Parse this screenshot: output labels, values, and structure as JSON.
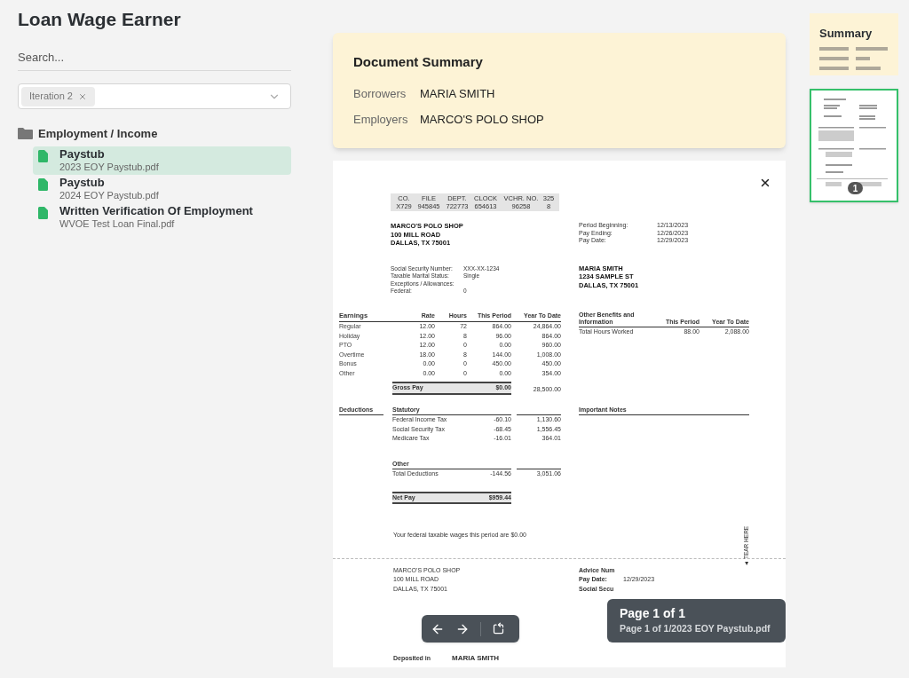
{
  "app_title": "Loan Wage Earner",
  "search": {
    "placeholder": "Search..."
  },
  "filter": {
    "chips": [
      {
        "label": "Iteration 2"
      }
    ]
  },
  "tree": [
    {
      "label": "Employment / Income",
      "children": [
        {
          "title": "Paystub",
          "file": "2023 EOY Paystub.pdf",
          "selected": true
        },
        {
          "title": "Paystub",
          "file": "2024 EOY Paystub.pdf",
          "selected": false
        },
        {
          "title": "Written Verification Of Employment",
          "file": "WVOE Test Loan Final.pdf",
          "selected": false
        }
      ]
    }
  ],
  "summary": {
    "title": "Document Summary",
    "fields": [
      {
        "label": "Borrowers",
        "value": "MARIA SMITH"
      },
      {
        "label": "Employers",
        "value": "MARCO'S POLO SHOP"
      }
    ]
  },
  "document": {
    "codes": {
      "headers": [
        "CO.",
        "FILE",
        "DEPT.",
        "CLOCK",
        "VCHR. NO.",
        "325"
      ],
      "values": [
        "X729",
        "945845",
        "722773",
        "654613",
        "96258",
        "8"
      ]
    },
    "employer": [
      "MARCO'S POLO SHOP",
      "100 MILL ROAD",
      "DALLAS, TX 75001"
    ],
    "period": [
      {
        "label": "Period Beginning:",
        "value": "12/13/2023"
      },
      {
        "label": "Pay Ending:",
        "value": "12/26/2023"
      },
      {
        "label": "Pay Date:",
        "value": "12/29/2023"
      }
    ],
    "tax_info": [
      {
        "label": "Social Security Number:",
        "value": "XXX-XX-1234"
      },
      {
        "label": "Taxable Marital Status:",
        "value": "Single"
      },
      {
        "label": "Exceptions / Allowances:"
      },
      {
        "label": "Federal:",
        "value": "0"
      }
    ],
    "employee": [
      "MARIA SMITH",
      "1234 SAMPLE ST",
      "DALLAS, TX 75001"
    ],
    "earnings": {
      "columns": [
        "Earnings",
        "Rate",
        "Hours",
        "This Period",
        "Year To Date"
      ],
      "rows": [
        [
          "Regular",
          "12.00",
          "72",
          "864.00",
          "24,864.00"
        ],
        [
          "Holiday",
          "12.00",
          "8",
          "96.00",
          "864.00"
        ],
        [
          "PTO",
          "12.00",
          "0",
          "0.00",
          "960.00"
        ],
        [
          "Overtime",
          "18.00",
          "8",
          "144.00",
          "1,008.00"
        ],
        [
          "Bonus",
          "0.00",
          "0",
          "450.00",
          "450.00"
        ],
        [
          "Other",
          "0.00",
          "0",
          "0.00",
          "354.00"
        ]
      ],
      "total": [
        "Gross Pay",
        "$0.00",
        "28,500.00"
      ]
    },
    "benefits": {
      "columns": [
        "Other Benefits and Information",
        "This Period",
        "Year To Date"
      ],
      "rows": [
        [
          "Total Hours Worked",
          "88.00",
          "2,088.00"
        ]
      ]
    },
    "deductions": {
      "title": "Deductions",
      "statutory": "Statutory",
      "rows": [
        [
          "Federal Income Tax",
          "-60.10",
          "1,130.60"
        ],
        [
          "Social Security Tax",
          "-68.45",
          "1,556.45"
        ],
        [
          "Medicare Tax",
          "-16.01",
          "364.01"
        ]
      ],
      "other": "Other",
      "total": [
        "Total Deductions",
        "-144.56",
        "3,051.06"
      ],
      "net": [
        "Net Pay",
        "$959.44"
      ]
    },
    "notes_heading": "Important Notes",
    "wages_note": "Your federal taxable wages this period are $0.00",
    "tear_label": "◄ TEAR HERE",
    "stub": {
      "employer": [
        "MARCO'S POLO SHOP",
        "100 MILL ROAD",
        "DALLAS, TX 75001"
      ],
      "details": [
        {
          "label": "Advice Num"
        },
        {
          "label": "Pay Date:",
          "value": "12/29/2023"
        },
        {
          "label": "Social Secu"
        }
      ]
    },
    "deposit": {
      "label": "Deposited in",
      "name": "MARIA SMITH"
    }
  },
  "viewer": {
    "page_label": "Page 1 of 1",
    "page_detail": "Page 1 of 1/2023 EOY Paystub.pdf"
  },
  "thumbnails": [
    {
      "kind": "summary",
      "label": "Summary",
      "selected": false
    },
    {
      "kind": "page",
      "badge": "1",
      "selected": true
    }
  ]
}
